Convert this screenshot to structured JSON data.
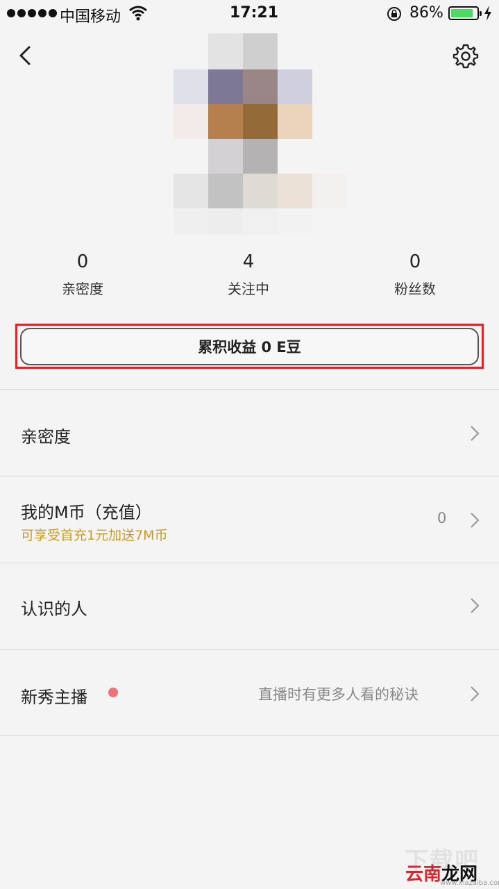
{
  "status_bar": {
    "carrier": "中国移动",
    "time": "17:21",
    "battery": "86%",
    "battery_level": 0.86
  },
  "header": {
    "back_icon": "chevron-left-icon",
    "settings_icon": "gear-icon"
  },
  "stats": [
    {
      "value": "0",
      "label": "亲密度"
    },
    {
      "value": "4",
      "label": "关注中"
    },
    {
      "value": "0",
      "label": "粉丝数"
    }
  ],
  "earnings_button": "累积收益 0 E豆",
  "menu": [
    {
      "title": "亲密度"
    },
    {
      "title": "我的M币（充值）",
      "subtitle": "可享受首充1元加送7M币",
      "value": "0"
    },
    {
      "title": "认识的人"
    },
    {
      "title": "新秀主播",
      "value": "直播时有更多人看的秘诀"
    }
  ],
  "watermark": {
    "top": "下载吧",
    "name_a": "云南",
    "name_b": "龙网",
    "url": "www.xiazaiba.com"
  },
  "colors": {
    "background": "#f4f4f4",
    "highlight_box": "#d9262c",
    "subtitle": "#c89b26",
    "badge_dot": "#f0707a",
    "battery_fill": "#4cd964"
  }
}
